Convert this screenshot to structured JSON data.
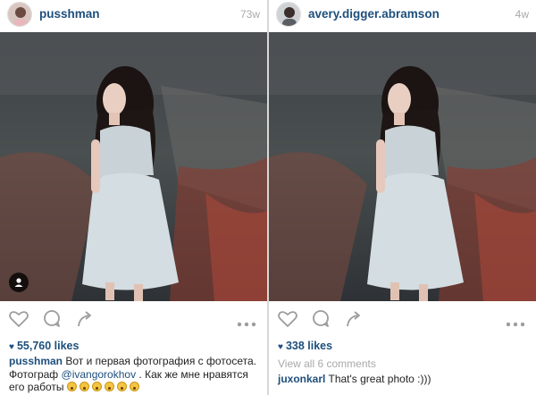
{
  "posts": [
    {
      "username": "pusshman",
      "time": "73w",
      "likes": "55,760 likes",
      "caption": {
        "username": "pusshman",
        "line1": "Вот и первая фотография с фотосета.",
        "line2_prefix": "Фотограф",
        "mention": "@ivangorokhov",
        "line2_suffix": ". Как же мне нравятся",
        "line3": "его работы",
        "emoji_count": 6
      }
    },
    {
      "username": "avery.digger.abramson",
      "time": "4w",
      "likes": "338 likes",
      "view_all": "View all 6 comments",
      "comment": {
        "username": "juxonkarl",
        "text": "That's great photo :)))"
      }
    }
  ],
  "icons": [
    "heart-icon",
    "comment-icon",
    "share-icon",
    "more-options-icon",
    "user-tag-icon"
  ],
  "colors": {
    "username": "#1e4f7c",
    "muted": "#a9a9a9",
    "icon": "#9c9c9c"
  }
}
